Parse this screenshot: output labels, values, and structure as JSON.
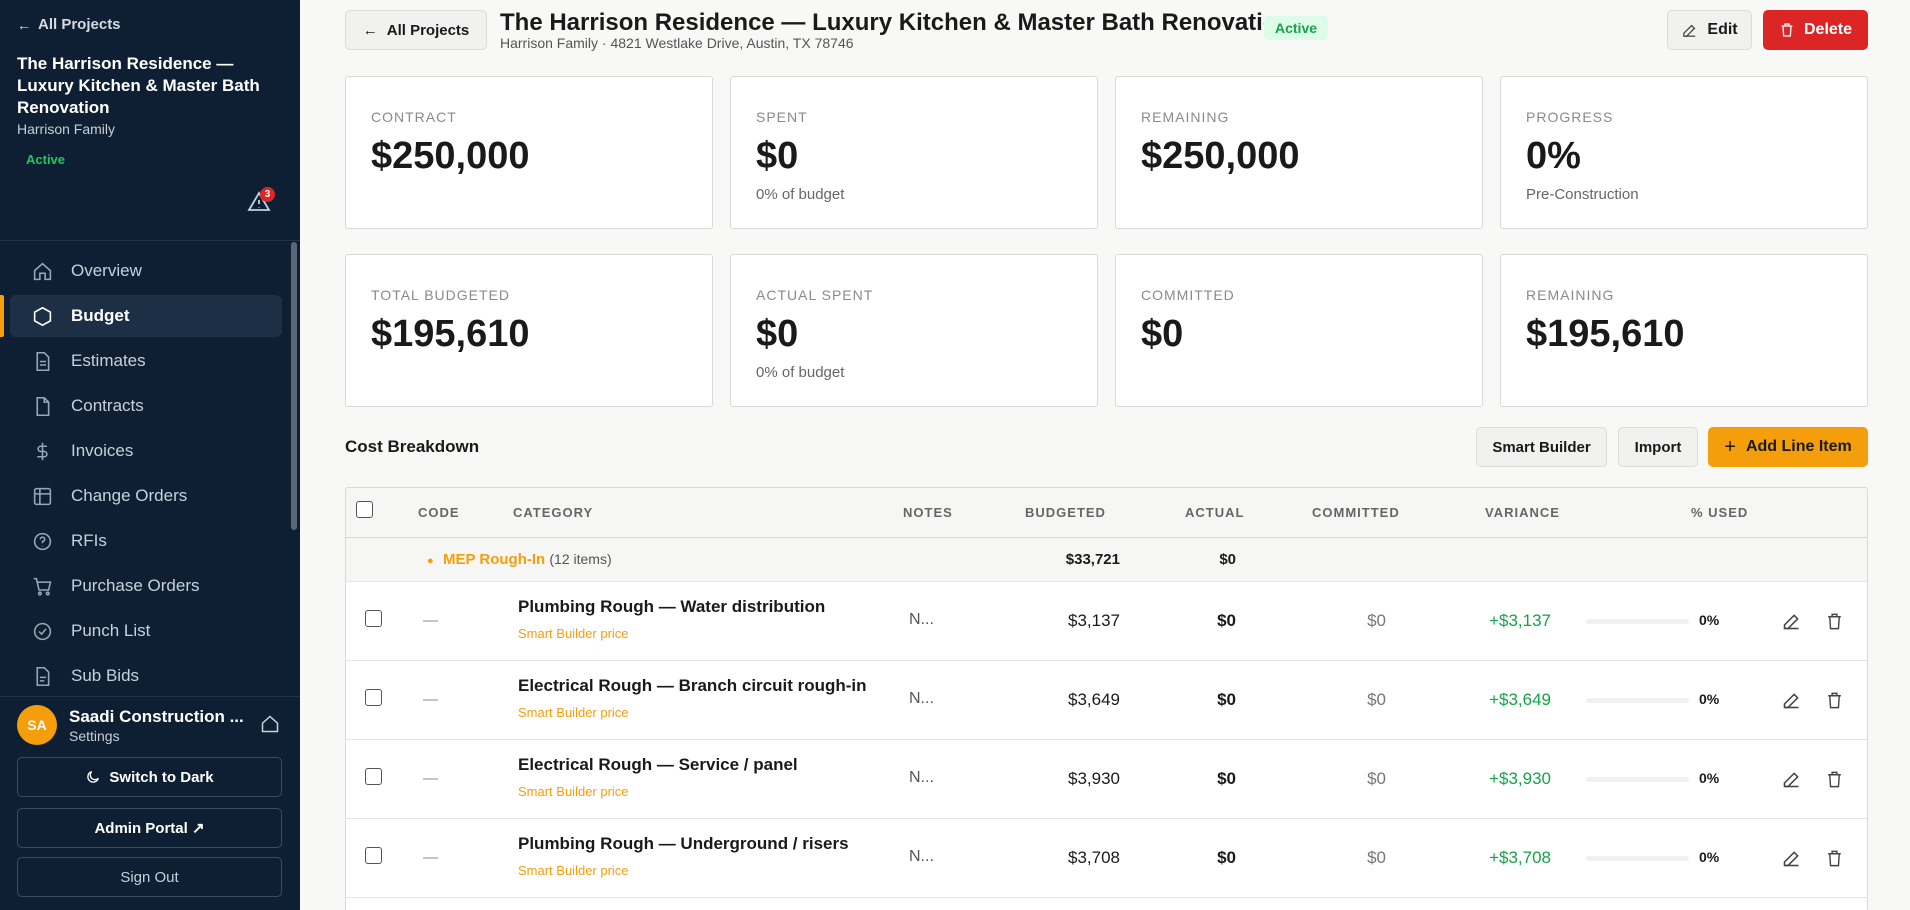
{
  "sidebar": {
    "back_label": "All Projects",
    "project_title": "The Harrison Residence — Luxury Kitchen & Master Bath Renovation",
    "client": "Harrison Family",
    "status": "Active",
    "alerts_count": "3",
    "nav": [
      {
        "label": "Overview",
        "icon": "home-icon"
      },
      {
        "label": "Budget",
        "icon": "hexagon-icon",
        "active": true
      },
      {
        "label": "Estimates",
        "icon": "document-icon"
      },
      {
        "label": "Contracts",
        "icon": "file-icon"
      },
      {
        "label": "Invoices",
        "icon": "dollar-icon"
      },
      {
        "label": "Change Orders",
        "icon": "table-icon"
      },
      {
        "label": "RFIs",
        "icon": "help-circle-icon"
      },
      {
        "label": "Purchase Orders",
        "icon": "cart-icon"
      },
      {
        "label": "Punch List",
        "icon": "check-circle-icon"
      },
      {
        "label": "Sub Bids",
        "icon": "clipboard-icon"
      }
    ],
    "user": {
      "initials": "SA",
      "name": "Saadi Construction ...",
      "sub": "Settings"
    },
    "theme_button": "Switch to Dark",
    "admin_button": "Admin Portal ↗",
    "signout_button": "Sign Out"
  },
  "header": {
    "back_label": "All Projects",
    "title": "The Harrison Residence — Luxury Kitchen & Master Bath Renovation",
    "status": "Active",
    "subtitle": "Harrison Family · 4821 Westlake Drive, Austin, TX 78746",
    "edit_label": "Edit",
    "delete_label": "Delete"
  },
  "stats_top": [
    {
      "label": "CONTRACT",
      "value": "$250,000",
      "note": ""
    },
    {
      "label": "SPENT",
      "value": "$0",
      "note": "0% of budget"
    },
    {
      "label": "REMAINING",
      "value": "$250,000",
      "note": ""
    },
    {
      "label": "PROGRESS",
      "value": "0%",
      "note": "Pre-Construction"
    }
  ],
  "stats_bottom": [
    {
      "label": "TOTAL BUDGETED",
      "value": "$195,610",
      "note": ""
    },
    {
      "label": "ACTUAL SPENT",
      "value": "$0",
      "note": "0% of budget"
    },
    {
      "label": "COMMITTED",
      "value": "$0",
      "note": ""
    },
    {
      "label": "REMAINING",
      "value": "$195,610",
      "note": ""
    }
  ],
  "cost_breakdown": {
    "title": "Cost Breakdown",
    "smart_builder_label": "Smart Builder",
    "import_label": "Import",
    "add_label": "Add Line Item",
    "columns": [
      "CODE",
      "CATEGORY",
      "NOTES",
      "BUDGETED",
      "ACTUAL",
      "COMMITTED",
      "VARIANCE",
      "% USED"
    ],
    "group": {
      "name": "MEP Rough-In",
      "count": "(12 items)",
      "budgeted": "$33,721",
      "actual": "$0"
    },
    "rows": [
      {
        "code": "—",
        "name": "Plumbing Rough — Water distribution",
        "source": "Smart Builder price",
        "notes": "N...",
        "budgeted": "$3,137",
        "actual": "$0",
        "committed": "$0",
        "variance": "+$3,137",
        "used_pct": "0%",
        "used_fraction": 0
      },
      {
        "code": "—",
        "name": "Electrical Rough — Branch circuit rough-in",
        "source": "Smart Builder price",
        "notes": "N...",
        "budgeted": "$3,649",
        "actual": "$0",
        "committed": "$0",
        "variance": "+$3,649",
        "used_pct": "0%",
        "used_fraction": 0
      },
      {
        "code": "—",
        "name": "Electrical Rough — Service / panel",
        "source": "Smart Builder price",
        "notes": "N...",
        "budgeted": "$3,930",
        "actual": "$0",
        "committed": "$0",
        "variance": "+$3,930",
        "used_pct": "0%",
        "used_fraction": 0
      },
      {
        "code": "—",
        "name": "Plumbing Rough — Underground / risers",
        "source": "Smart Builder price",
        "notes": "N...",
        "budgeted": "$3,708",
        "actual": "$0",
        "committed": "$0",
        "variance": "+$3,708",
        "used_pct": "0%",
        "used_fraction": 0
      }
    ]
  },
  "colors": {
    "sidebar_bg": "#0f1f33",
    "accent": "#f59e0b",
    "danger": "#dc2626",
    "success": "#16a34a"
  }
}
